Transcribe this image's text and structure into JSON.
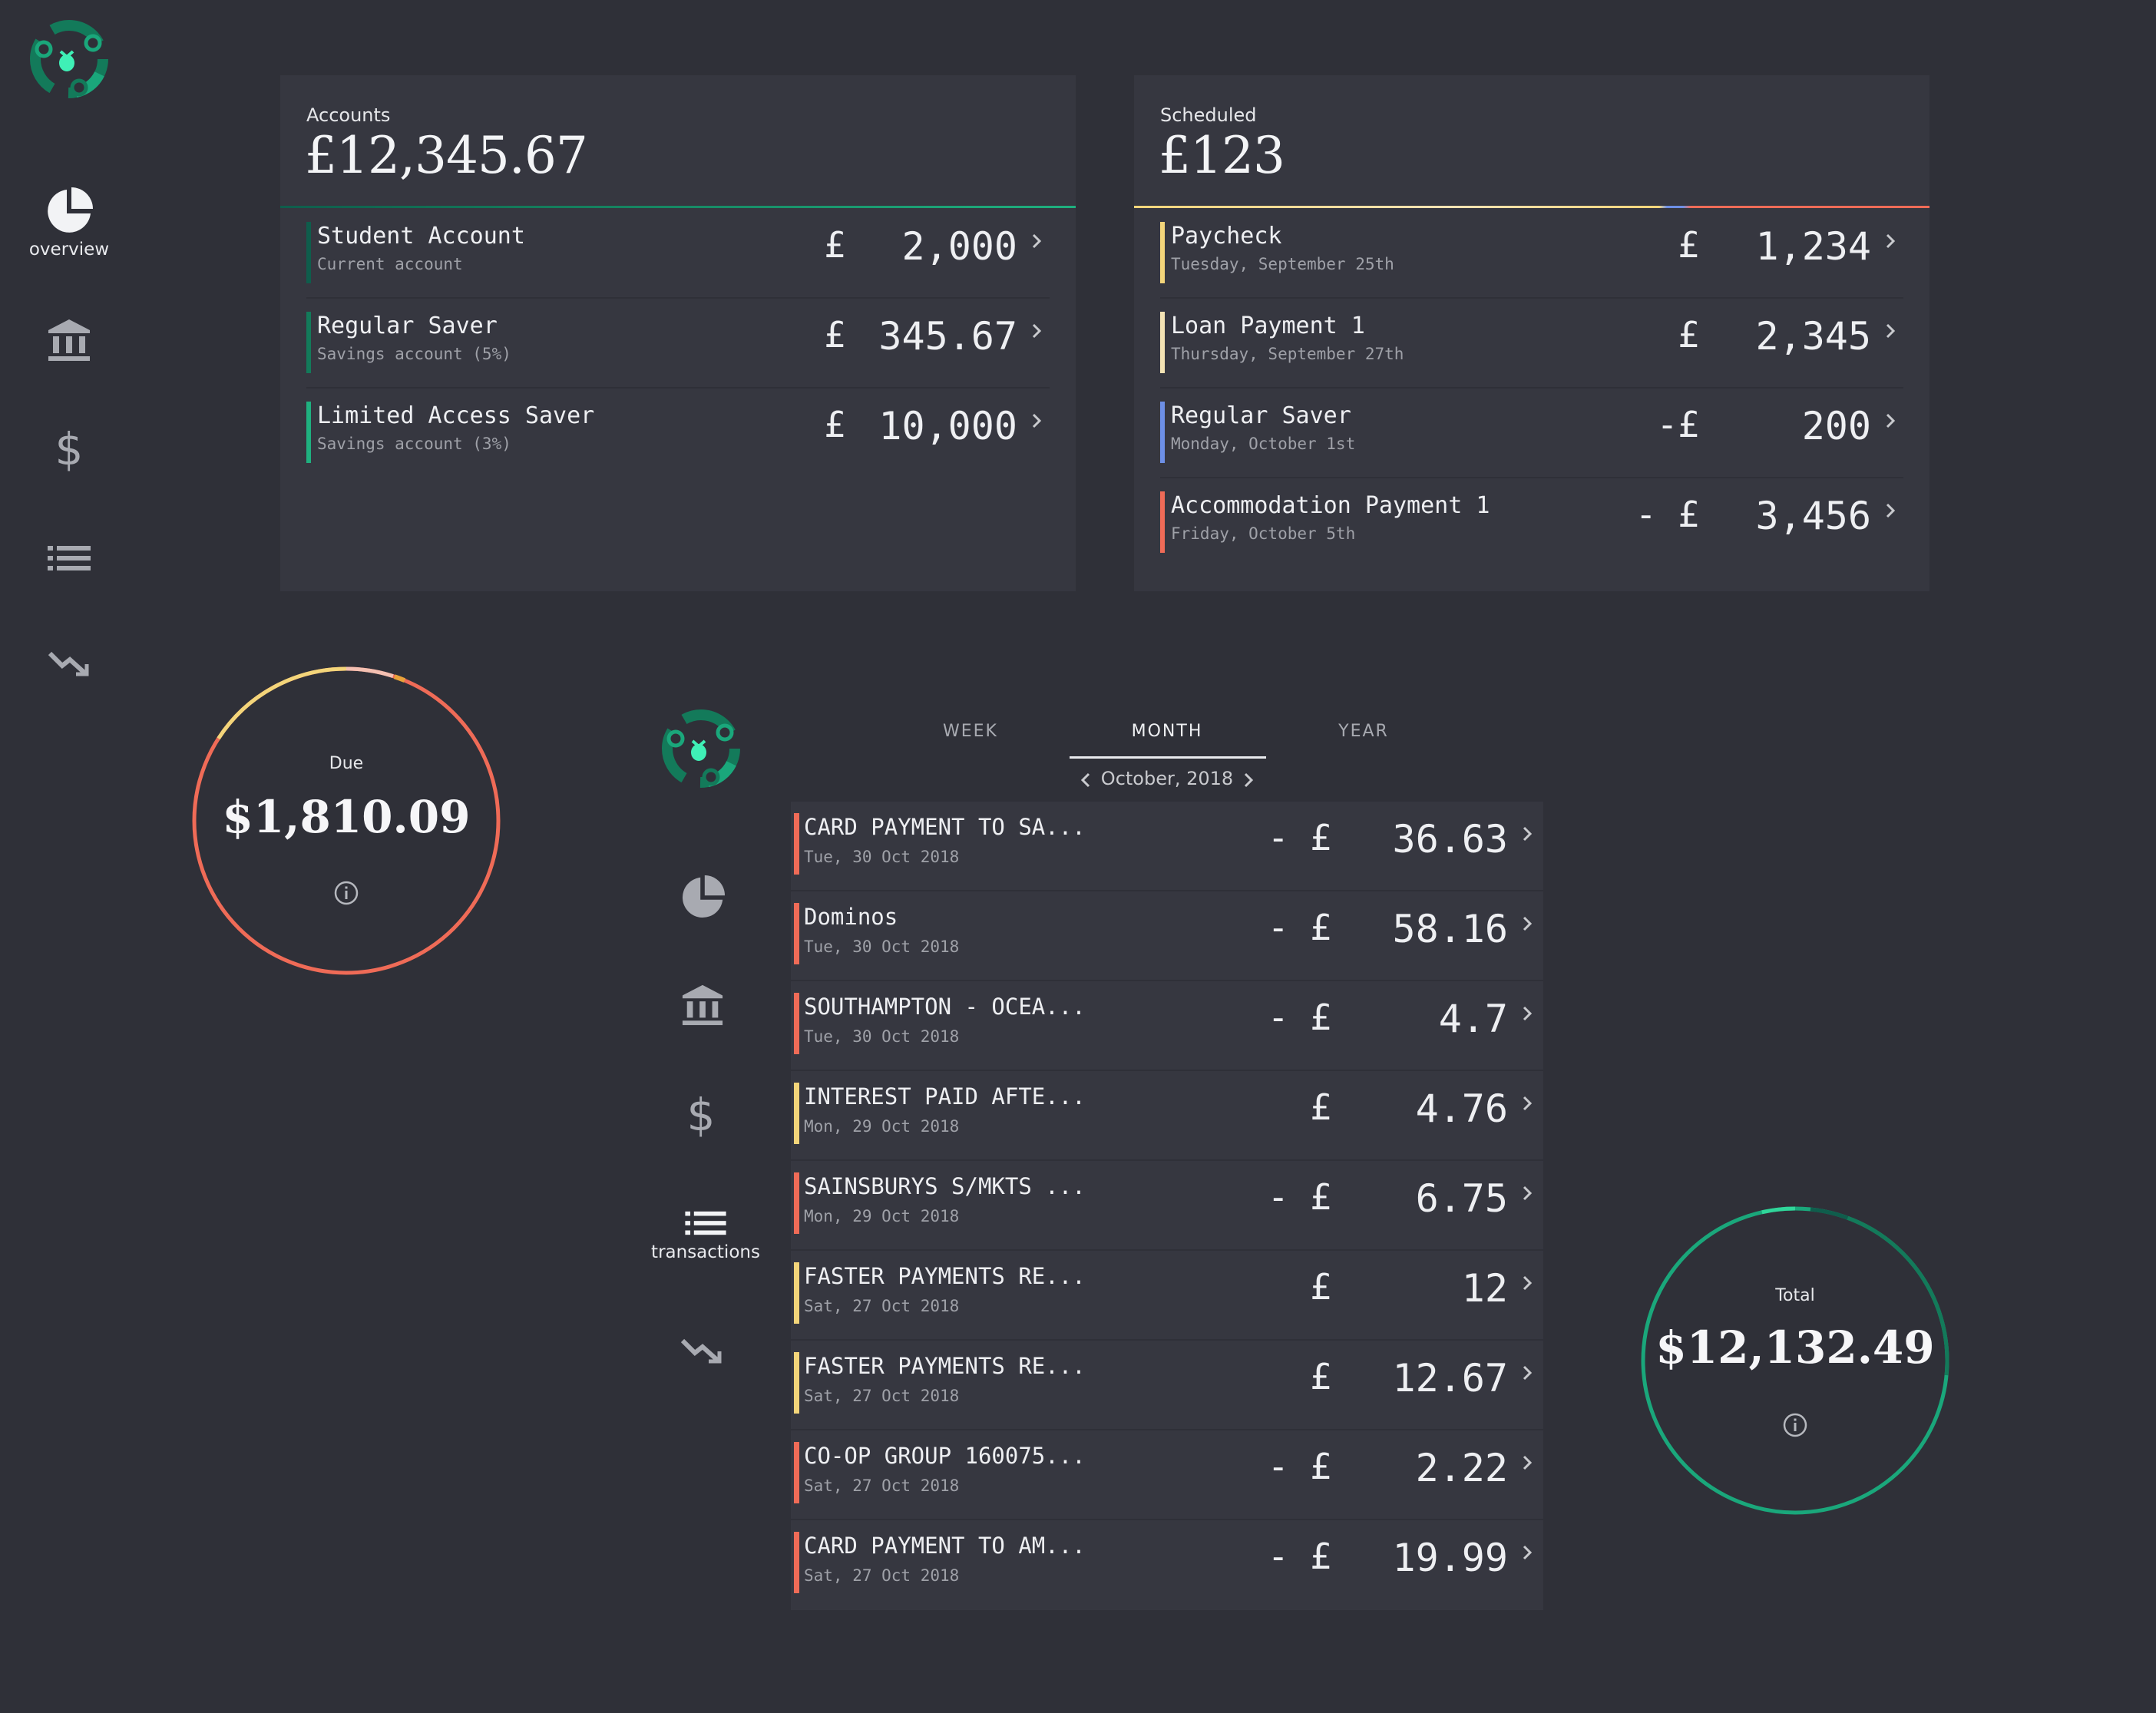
{
  "colors": {
    "background": "#2f3038",
    "card": "#363740",
    "green": "#1aa77b",
    "yellow": "#f3d57a",
    "cream": "#f4e3b4",
    "blue": "#6d8fe6",
    "red": "#ef6b57"
  },
  "nav": {
    "items": [
      {
        "icon": "pie-chart-icon",
        "label": "overview",
        "active": true
      },
      {
        "icon": "bank-icon",
        "label": ""
      },
      {
        "icon": "dollar-icon",
        "label": ""
      },
      {
        "icon": "list-icon",
        "label": ""
      },
      {
        "icon": "trend-down-icon",
        "label": ""
      }
    ]
  },
  "accounts": {
    "label": "Accounts",
    "total": "£12,345.67",
    "items": [
      {
        "name": "Student Account",
        "type": "Current account",
        "sign": "£",
        "amount": "2,000",
        "color": "#0f5d4c"
      },
      {
        "name": "Regular Saver",
        "type": "Savings account (5%)",
        "sign": "£",
        "amount": "345.67",
        "color": "#137a5a"
      },
      {
        "name": "Limited Access Saver",
        "type": "Savings account (3%)",
        "sign": "£",
        "amount": "10,000",
        "color": "#1fb07f"
      }
    ]
  },
  "scheduled": {
    "label": "Scheduled",
    "total": "£123",
    "items": [
      {
        "name": "Paycheck",
        "date": "Tuesday, September 25th",
        "sign": "£",
        "amount": "1,234",
        "color": "#f3d57a"
      },
      {
        "name": "Loan Payment 1",
        "date": "Thursday, September 27th",
        "sign": "£",
        "amount": "2,345",
        "color": "#f4e3b4"
      },
      {
        "name": "Regular Saver",
        "date": "Monday, October 1st",
        "sign": "-£",
        "amount": "200",
        "color": "#6d8fe6"
      },
      {
        "name": "Accommodation Payment 1",
        "date": "Friday, October 5th",
        "sign": "- £",
        "amount": "3,456",
        "color": "#ef6b57"
      }
    ]
  },
  "due": {
    "label": "Due",
    "value": "$1,810.09",
    "icon": "info-icon"
  },
  "total_ring": {
    "label": "Total",
    "value": "$12,132.49",
    "icon": "info-icon"
  },
  "transactions": {
    "nav_active_label": "transactions",
    "tabs": [
      "WEEK",
      "MONTH",
      "YEAR"
    ],
    "active_tab": "MONTH",
    "period": "October, 2018",
    "items": [
      {
        "name": "CARD PAYMENT TO SA...",
        "date": "Tue, 30 Oct 2018",
        "sign": "- £",
        "amount": "36.63",
        "color": "#ef6b57"
      },
      {
        "name": "Dominos",
        "date": "Tue, 30 Oct 2018",
        "sign": "- £",
        "amount": "58.16",
        "color": "#ef6b57"
      },
      {
        "name": "SOUTHAMPTON - OCEA...",
        "date": "Tue, 30 Oct 2018",
        "sign": "- £",
        "amount": "4.7",
        "color": "#ef6b57"
      },
      {
        "name": "INTEREST PAID AFTE...",
        "date": "Mon, 29 Oct 2018",
        "sign": "£",
        "amount": "4.76",
        "color": "#f3d57a"
      },
      {
        "name": "SAINSBURYS S/MKTS ...",
        "date": "Mon, 29 Oct 2018",
        "sign": "- £",
        "amount": "6.75",
        "color": "#ef6b57"
      },
      {
        "name": "FASTER PAYMENTS RE...",
        "date": "Sat, 27 Oct 2018",
        "sign": "£",
        "amount": "12",
        "color": "#f3d57a"
      },
      {
        "name": "FASTER PAYMENTS RE...",
        "date": "Sat, 27 Oct 2018",
        "sign": "£",
        "amount": "12.67",
        "color": "#f3d57a"
      },
      {
        "name": "CO-OP GROUP 160075...",
        "date": "Sat, 27 Oct 2018",
        "sign": "- £",
        "amount": "2.22",
        "color": "#ef6b57"
      },
      {
        "name": "CARD PAYMENT TO AM...",
        "date": "Sat, 27 Oct 2018",
        "sign": "- £",
        "amount": "19.99",
        "color": "#ef6b57"
      }
    ]
  }
}
